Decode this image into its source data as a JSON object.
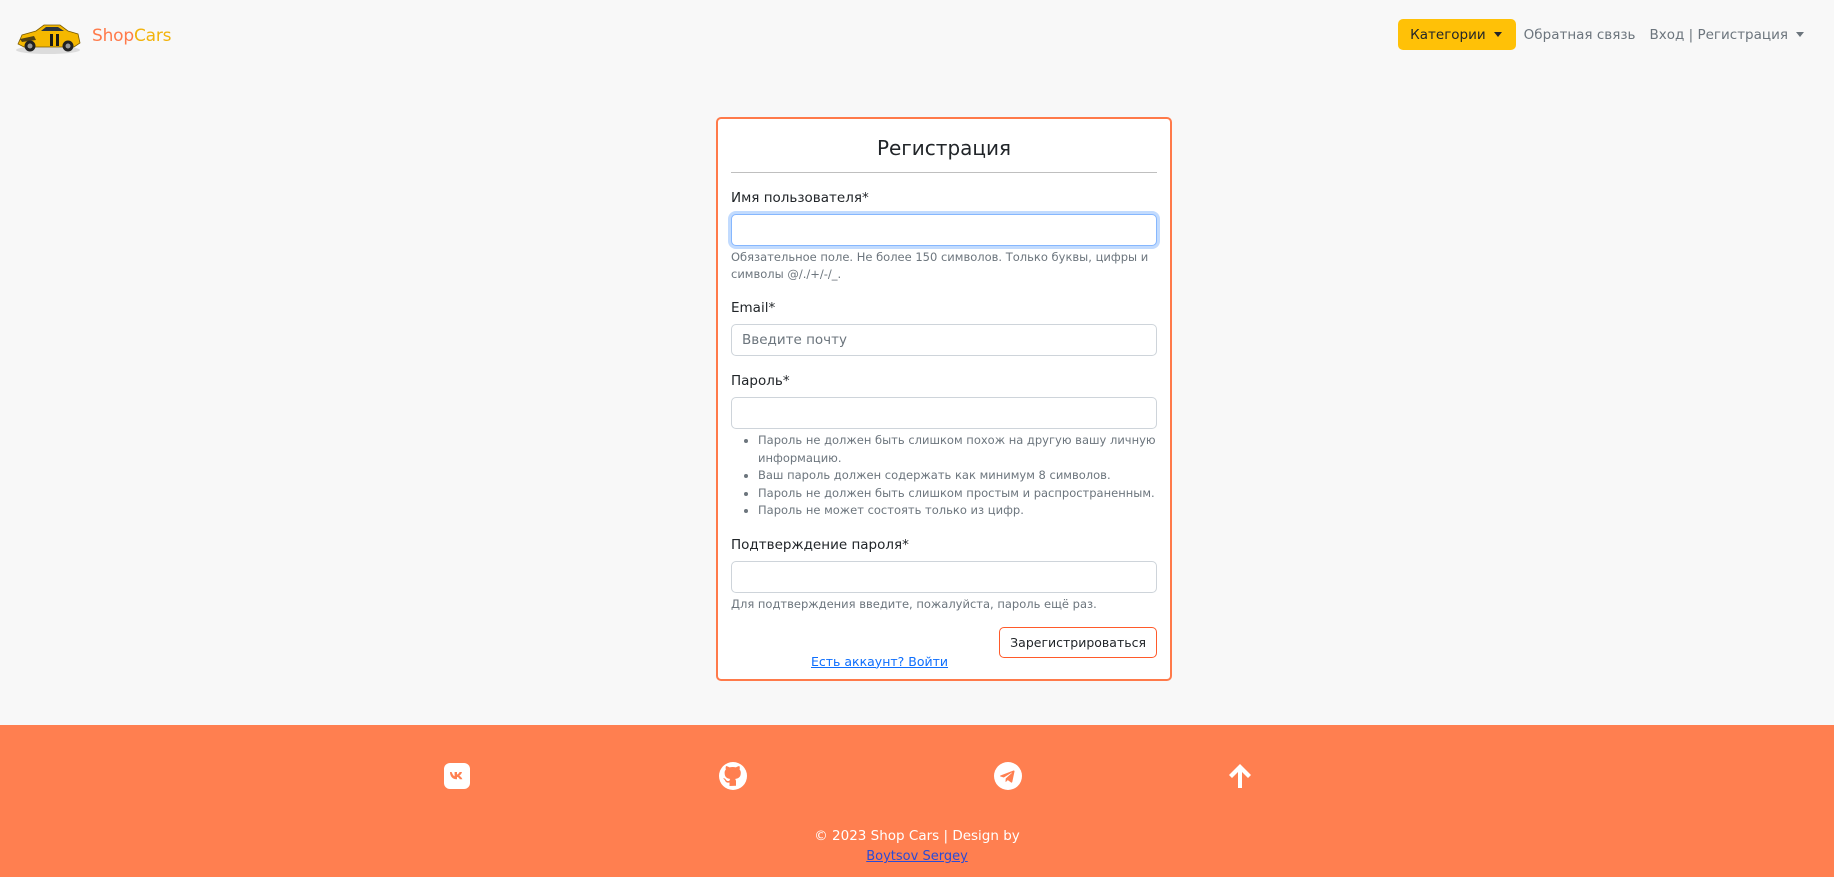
{
  "brand": {
    "name_part1": "Shop",
    "name_part2": "Cars",
    "colors": {
      "shop": "#ff7a4a",
      "cars": "#f2b30d"
    },
    "logo_icon": "car-logo-icon"
  },
  "nav": {
    "categories_label": "Категории",
    "feedback_label": "Обратная связь",
    "auth_label": "Вход | Регистрация",
    "categories_color": "#ffc107"
  },
  "form": {
    "title": "Регистрация",
    "username": {
      "label": "Имя пользователя*",
      "value": "",
      "help": "Обязательное поле. Не более 150 символов. Только буквы, цифры и символы @/./+/-/_."
    },
    "email": {
      "label": "Email*",
      "placeholder": "Введите почту"
    },
    "password": {
      "label": "Пароль*",
      "rules": [
        "Пароль не должен быть слишком похож на другую вашу личную информацию.",
        "Ваш пароль должен содержать как минимум 8 символов.",
        "Пароль не должен быть слишком простым и распространенным.",
        "Пароль не может состоять только из цифр."
      ]
    },
    "password_confirm": {
      "label": "Подтверждение пароля*",
      "help": "Для подтверждения введите, пожалуйста, пароль ещё раз."
    },
    "submit_label": "Зарегистрироваться",
    "login_link": "Есть аккаунт? Войти",
    "accent_color": "#ff7a4a"
  },
  "footer": {
    "background": "#ff7f50",
    "icons": [
      "vk-icon",
      "github-icon",
      "telegram-icon",
      "arrow-up-icon"
    ],
    "copyright": "© 2023 Shop Cars | Design by",
    "author": "Boytsov Sergey"
  }
}
